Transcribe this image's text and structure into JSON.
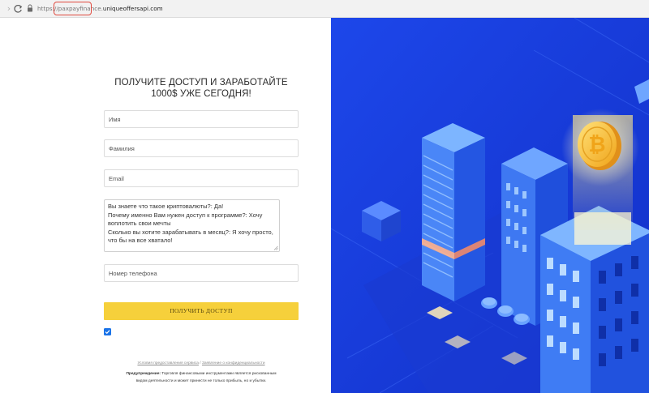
{
  "browser": {
    "url_protocol": "https://",
    "url_highlighted": "paxpayfinance.",
    "url_domain": "uniqueoffersapi.com"
  },
  "form": {
    "headline_line1": "ПОЛУЧИТЕ ДОСТУП И ЗАРАБОТАЙТЕ",
    "headline_line2": "1000$ УЖЕ СЕГОДНЯ!",
    "first_name_placeholder": "Имя",
    "last_name_placeholder": "Фамилия",
    "email_placeholder": "Email",
    "message_lines": [
      "Вы знаете что такое криптовалюты?: Да!",
      "Почему именно Вам нужен доступ к программе?: Хочу",
      "воплотить свои мечты",
      "Сколько вы хотите зарабатывать в месяц?: Я хочу просто,",
      "что бы на все хватало!"
    ],
    "phone_placeholder": "Номер телефона",
    "submit_label": "ПОЛУЧИТЬ ДОСТУП",
    "checkbox_checked": true
  },
  "footer": {
    "terms_link": "Условия предоставления сервиса",
    "separator": " / ",
    "privacy_link": "Заявление о конфиденциальности",
    "warning_label": "Предупреждение:",
    "warning_text_line1": " Торговля финансовыми инструментами является рискованным",
    "warning_text_line2": "видом деятельности и может принести не только прибыль, но и убытки."
  },
  "colors": {
    "accent_button": "#f6d03b",
    "checkbox": "#1a73e8",
    "illustration_bg": "#1a3fe0",
    "url_highlight_box": "#e04a3f"
  },
  "icons": {
    "reload": "reload-icon",
    "lock": "lock-icon",
    "coin": "bitcoin-coin-icon"
  }
}
